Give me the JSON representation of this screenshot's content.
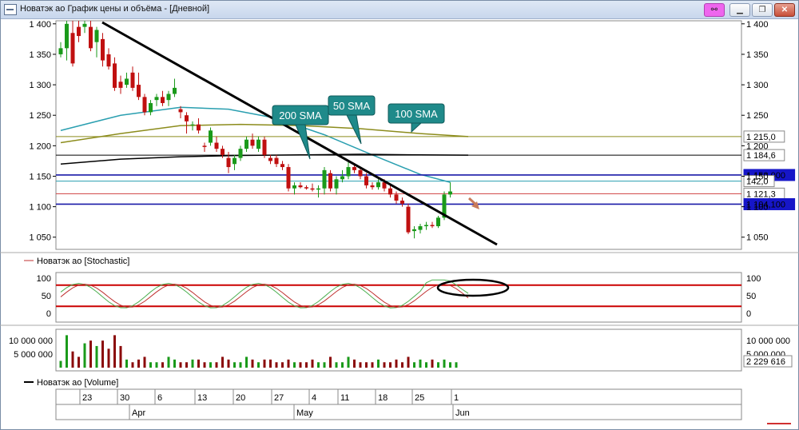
{
  "window": {
    "title": "Новатэк ао График цены и объёма - [Дневной]",
    "buttons": [
      "link",
      "minimize",
      "restore",
      "close"
    ]
  },
  "chart_data": {
    "type": "candlestick",
    "price_panel": {
      "y_ticks": [
        "1 400",
        "1 350",
        "1 300",
        "1 250",
        "1 200",
        "1 150",
        "1 100",
        "1 050"
      ],
      "ylim": [
        1030,
        1405
      ],
      "candles": [
        {
          "o": 1350,
          "h": 1370,
          "l": 1345,
          "c": 1360
        },
        {
          "o": 1360,
          "h": 1405,
          "l": 1340,
          "c": 1400
        },
        {
          "o": 1385,
          "h": 1405,
          "l": 1330,
          "c": 1335
        },
        {
          "o": 1395,
          "h": 1405,
          "l": 1370,
          "c": 1380
        },
        {
          "o": 1395,
          "h": 1405,
          "l": 1385,
          "c": 1400
        },
        {
          "o": 1395,
          "h": 1405,
          "l": 1355,
          "c": 1360
        },
        {
          "o": 1370,
          "h": 1395,
          "l": 1345,
          "c": 1390
        },
        {
          "o": 1375,
          "h": 1385,
          "l": 1330,
          "c": 1340
        },
        {
          "o": 1350,
          "h": 1360,
          "l": 1325,
          "c": 1330
        },
        {
          "o": 1335,
          "h": 1345,
          "l": 1290,
          "c": 1295
        },
        {
          "o": 1305,
          "h": 1315,
          "l": 1285,
          "c": 1295
        },
        {
          "o": 1300,
          "h": 1320,
          "l": 1295,
          "c": 1310
        },
        {
          "o": 1320,
          "h": 1330,
          "l": 1290,
          "c": 1295
        },
        {
          "o": 1300,
          "h": 1320,
          "l": 1275,
          "c": 1280
        },
        {
          "o": 1280,
          "h": 1285,
          "l": 1250,
          "c": 1255
        },
        {
          "o": 1255,
          "h": 1275,
          "l": 1250,
          "c": 1270
        },
        {
          "o": 1275,
          "h": 1285,
          "l": 1265,
          "c": 1280
        },
        {
          "o": 1280,
          "h": 1290,
          "l": 1265,
          "c": 1270
        },
        {
          "o": 1275,
          "h": 1290,
          "l": 1265,
          "c": 1285
        },
        {
          "o": 1285,
          "h": 1310,
          "l": 1280,
          "c": 1295
        },
        {
          "o": 1260,
          "h": 1265,
          "l": 1245,
          "c": 1255
        },
        {
          "o": 1250,
          "h": 1255,
          "l": 1220,
          "c": 1240
        },
        {
          "o": 1235,
          "h": 1240,
          "l": 1225,
          "c": 1235
        },
        {
          "o": 1235,
          "h": 1245,
          "l": 1220,
          "c": 1225
        },
        {
          "o": 1200,
          "h": 1205,
          "l": 1190,
          "c": 1198
        },
        {
          "o": 1205,
          "h": 1230,
          "l": 1200,
          "c": 1225
        },
        {
          "o": 1205,
          "h": 1215,
          "l": 1190,
          "c": 1195
        },
        {
          "o": 1195,
          "h": 1200,
          "l": 1180,
          "c": 1185
        },
        {
          "o": 1180,
          "h": 1190,
          "l": 1155,
          "c": 1165
        },
        {
          "o": 1170,
          "h": 1185,
          "l": 1160,
          "c": 1180
        },
        {
          "o": 1180,
          "h": 1200,
          "l": 1175,
          "c": 1195
        },
        {
          "o": 1195,
          "h": 1215,
          "l": 1190,
          "c": 1210
        },
        {
          "o": 1210,
          "h": 1220,
          "l": 1195,
          "c": 1200
        },
        {
          "o": 1195,
          "h": 1215,
          "l": 1190,
          "c": 1210
        },
        {
          "o": 1210,
          "h": 1215,
          "l": 1180,
          "c": 1185
        },
        {
          "o": 1180,
          "h": 1185,
          "l": 1170,
          "c": 1175
        },
        {
          "o": 1180,
          "h": 1185,
          "l": 1165,
          "c": 1170
        },
        {
          "o": 1170,
          "h": 1175,
          "l": 1160,
          "c": 1165
        },
        {
          "o": 1165,
          "h": 1170,
          "l": 1125,
          "c": 1130
        },
        {
          "o": 1130,
          "h": 1140,
          "l": 1120,
          "c": 1135
        },
        {
          "o": 1135,
          "h": 1140,
          "l": 1130,
          "c": 1132
        },
        {
          "o": 1132,
          "h": 1135,
          "l": 1128,
          "c": 1130
        },
        {
          "o": 1130,
          "h": 1138,
          "l": 1125,
          "c": 1128
        },
        {
          "o": 1128,
          "h": 1135,
          "l": 1115,
          "c": 1130
        },
        {
          "o": 1130,
          "h": 1165,
          "l": 1120,
          "c": 1160
        },
        {
          "o": 1155,
          "h": 1160,
          "l": 1125,
          "c": 1130
        },
        {
          "o": 1130,
          "h": 1150,
          "l": 1120,
          "c": 1145
        },
        {
          "o": 1145,
          "h": 1160,
          "l": 1140,
          "c": 1150
        },
        {
          "o": 1150,
          "h": 1175,
          "l": 1145,
          "c": 1165
        },
        {
          "o": 1165,
          "h": 1170,
          "l": 1155,
          "c": 1160
        },
        {
          "o": 1160,
          "h": 1165,
          "l": 1145,
          "c": 1150
        },
        {
          "o": 1150,
          "h": 1155,
          "l": 1130,
          "c": 1135
        },
        {
          "o": 1135,
          "h": 1140,
          "l": 1128,
          "c": 1132
        },
        {
          "o": 1132,
          "h": 1145,
          "l": 1128,
          "c": 1140
        },
        {
          "o": 1140,
          "h": 1145,
          "l": 1125,
          "c": 1130
        },
        {
          "o": 1130,
          "h": 1135,
          "l": 1115,
          "c": 1120
        },
        {
          "o": 1120,
          "h": 1125,
          "l": 1105,
          "c": 1110
        },
        {
          "o": 1110,
          "h": 1115,
          "l": 1100,
          "c": 1105
        },
        {
          "o": 1100,
          "h": 1105,
          "l": 1055,
          "c": 1058
        },
        {
          "o": 1060,
          "h": 1068,
          "l": 1048,
          "c": 1063
        },
        {
          "o": 1062,
          "h": 1072,
          "l": 1056,
          "c": 1068
        },
        {
          "o": 1068,
          "h": 1075,
          "l": 1062,
          "c": 1070
        },
        {
          "o": 1070,
          "h": 1075,
          "l": 1065,
          "c": 1068
        },
        {
          "o": 1068,
          "h": 1085,
          "l": 1065,
          "c": 1082
        },
        {
          "o": 1082,
          "h": 1125,
          "l": 1078,
          "c": 1120
        },
        {
          "o": 1120,
          "h": 1140,
          "l": 1115,
          "c": 1125
        }
      ],
      "sma": [
        {
          "name": "50 SMA",
          "color": "#2a9fb0",
          "points": [
            [
              0,
              1225
            ],
            [
              10,
              1250
            ],
            [
              20,
              1263
            ],
            [
              28,
              1260
            ],
            [
              36,
              1245
            ],
            [
              44,
              1218
            ],
            [
              52,
              1185
            ],
            [
              60,
              1153
            ],
            [
              65,
              1140
            ]
          ]
        },
        {
          "name": "100 SMA",
          "color": "#8c8c1c",
          "points": [
            [
              0,
              1205
            ],
            [
              10,
              1220
            ],
            [
              20,
              1233
            ],
            [
              30,
              1235
            ],
            [
              40,
              1233
            ],
            [
              50,
              1228
            ],
            [
              60,
              1220
            ],
            [
              68,
              1215
            ]
          ]
        },
        {
          "name": "200 SMA",
          "color": "#000000",
          "points": [
            [
              0,
              1170
            ],
            [
              10,
              1178
            ],
            [
              20,
              1182
            ],
            [
              30,
              1184
            ],
            [
              40,
              1185
            ],
            [
              50,
              1186
            ],
            [
              60,
              1185
            ],
            [
              68,
              1184.6
            ]
          ]
        }
      ],
      "h_lines": [
        {
          "value": 1152.0,
          "color": "#1a1aa8",
          "label": "1 152,000",
          "label_bg": "#1616c8"
        },
        {
          "value": 1142.0,
          "color": "#2a9fb0",
          "label": "142,0",
          "label_bg": "#ffffff"
        },
        {
          "value": 1121.3,
          "color": "#d04040",
          "label": "1 121,3",
          "label_bg": "#ffffff"
        },
        {
          "value": 1104.1,
          "color": "#1a1aa8",
          "label": "1 104,100",
          "label_bg": "#1616c8"
        },
        {
          "value": 1184.6,
          "color": "#000000",
          "label": "1 184,6",
          "label_bg": "#ffffff"
        },
        {
          "value": 1215.0,
          "color": "#8c8c1c",
          "label": "1 215,0",
          "label_bg": "#ffffff"
        }
      ],
      "callouts": [
        "200 SMA",
        "50 SMA",
        "100 SMA"
      ]
    },
    "stochastic_panel": {
      "legend": "Новатэк ао [Stochastic]",
      "y_ticks": [
        "100",
        "50",
        "0"
      ],
      "levels": [
        80,
        20
      ]
    },
    "volume_panel": {
      "legend": "Новатэк ао [Volume]",
      "y_ticks": [
        "10 000 000",
        "5 000 000"
      ],
      "last_value": "2 229 616",
      "values": [
        2.5,
        12,
        6,
        4,
        9,
        10,
        8,
        10,
        7,
        12,
        8,
        3,
        2,
        3,
        4,
        2,
        2,
        2,
        4,
        3,
        2,
        2,
        3,
        3,
        2,
        2,
        2,
        4,
        3,
        2,
        2,
        4,
        3,
        2,
        3,
        3,
        2,
        2,
        3,
        2,
        2,
        2,
        3,
        2,
        2,
        4,
        2,
        2,
        4,
        3,
        2,
        2,
        2,
        3,
        2,
        2,
        3,
        2,
        4,
        2,
        3,
        2,
        3,
        2,
        3,
        2,
        2
      ]
    },
    "x_axis": {
      "day_ticks": [
        "23",
        "30",
        "6",
        "13",
        "20",
        "27",
        "4",
        "11",
        "18",
        "25",
        "1"
      ],
      "month_ticks": [
        "Apr",
        "May",
        "Jun"
      ]
    }
  }
}
